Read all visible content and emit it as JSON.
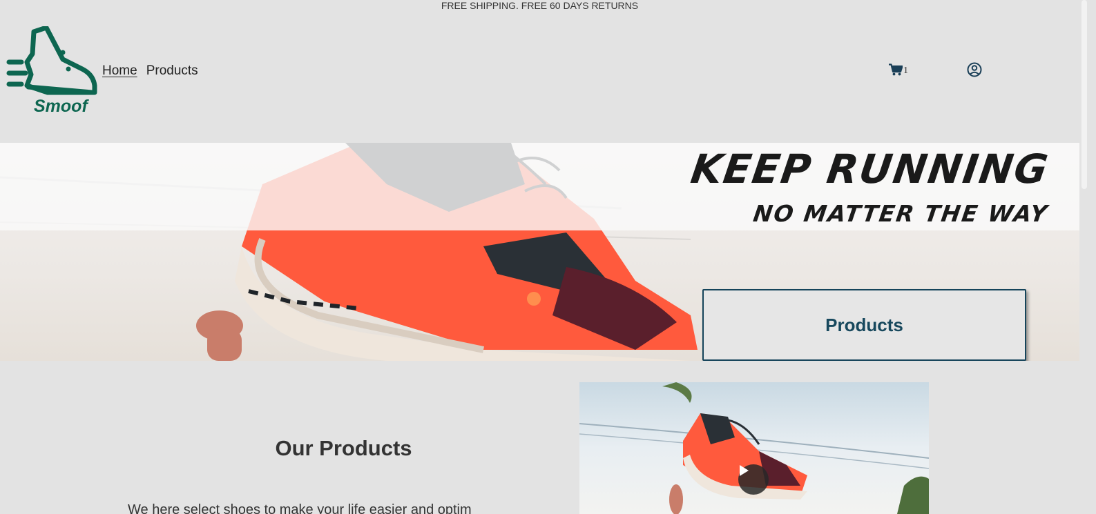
{
  "announcement": "FREE SHIPPING. FREE 60 DAYS RETURNS",
  "logo": {
    "text": "Smoof",
    "color": "#0d6650"
  },
  "nav": {
    "home": "Home",
    "products": "Products"
  },
  "cart": {
    "count": "1",
    "icon": "shopping-cart-icon"
  },
  "account": {
    "icon": "user-circle-icon"
  },
  "hero": {
    "title": "KEEP RUNNING",
    "subtitle": "NO MATTER THE WAY",
    "button_label": "Products",
    "button_color": "#17485d"
  },
  "products_section": {
    "title": "Our Products",
    "text": "We here select shoes to make your life easier and optim"
  },
  "video": {
    "icon": "play-icon"
  }
}
